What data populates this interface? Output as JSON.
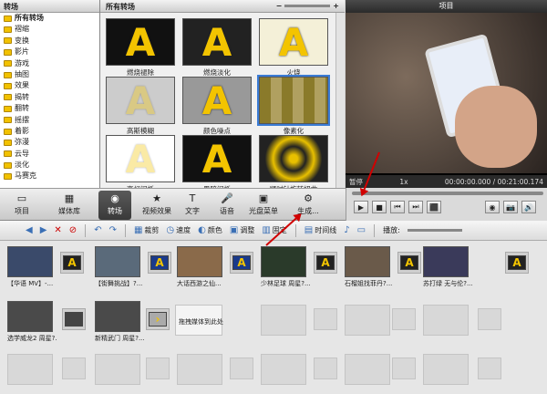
{
  "tree": {
    "title": "转场",
    "items": [
      "所有转场",
      "褶缩",
      "变换",
      "影片",
      "游戏",
      "抽图",
      "效果",
      "揭转",
      "翻转",
      "摇摆",
      "着影",
      "弥漫",
      "云导",
      "淡化",
      "马赛克"
    ]
  },
  "gallery": {
    "title": "所有转场",
    "tiles": [
      "燃烧褪除",
      "燃烧淡化",
      "火烧",
      "高斯模糊",
      "颜色噪点",
      "像素化",
      "亮灯闪烁",
      "黑暗闪烁",
      "顺时针旋转扭曲"
    ]
  },
  "preview": {
    "title": "项目",
    "state": "暂停",
    "time_current": "00:00:00.000",
    "time_total": "00:21:00.174",
    "zoom": "1x"
  },
  "toolbar": {
    "items": [
      "项目",
      "媒体库",
      "转场",
      "视频效果",
      "文字",
      "语音",
      "光盘菜单",
      "生成..."
    ]
  },
  "toolbar2": {
    "items": [
      "裁剪",
      "速度",
      "颜色",
      "调整",
      "固定",
      "时间线",
      "播放:"
    ]
  },
  "timeline": {
    "clips": [
      "【华语 MV】-...",
      "【街舞挑战】?...",
      "大话西游之仙...",
      "少林足球 周星?...",
      "石榴姐找菲丹?...",
      "苏打绿 无与伦?...",
      "选学威龙2 周星?...",
      "新精武门 周星?..."
    ],
    "drop_hint": "拖拽媒体到此处"
  },
  "colors": {
    "accent": "#f3c400",
    "arrow": "#d10000",
    "selection": "#3a7bd5"
  }
}
